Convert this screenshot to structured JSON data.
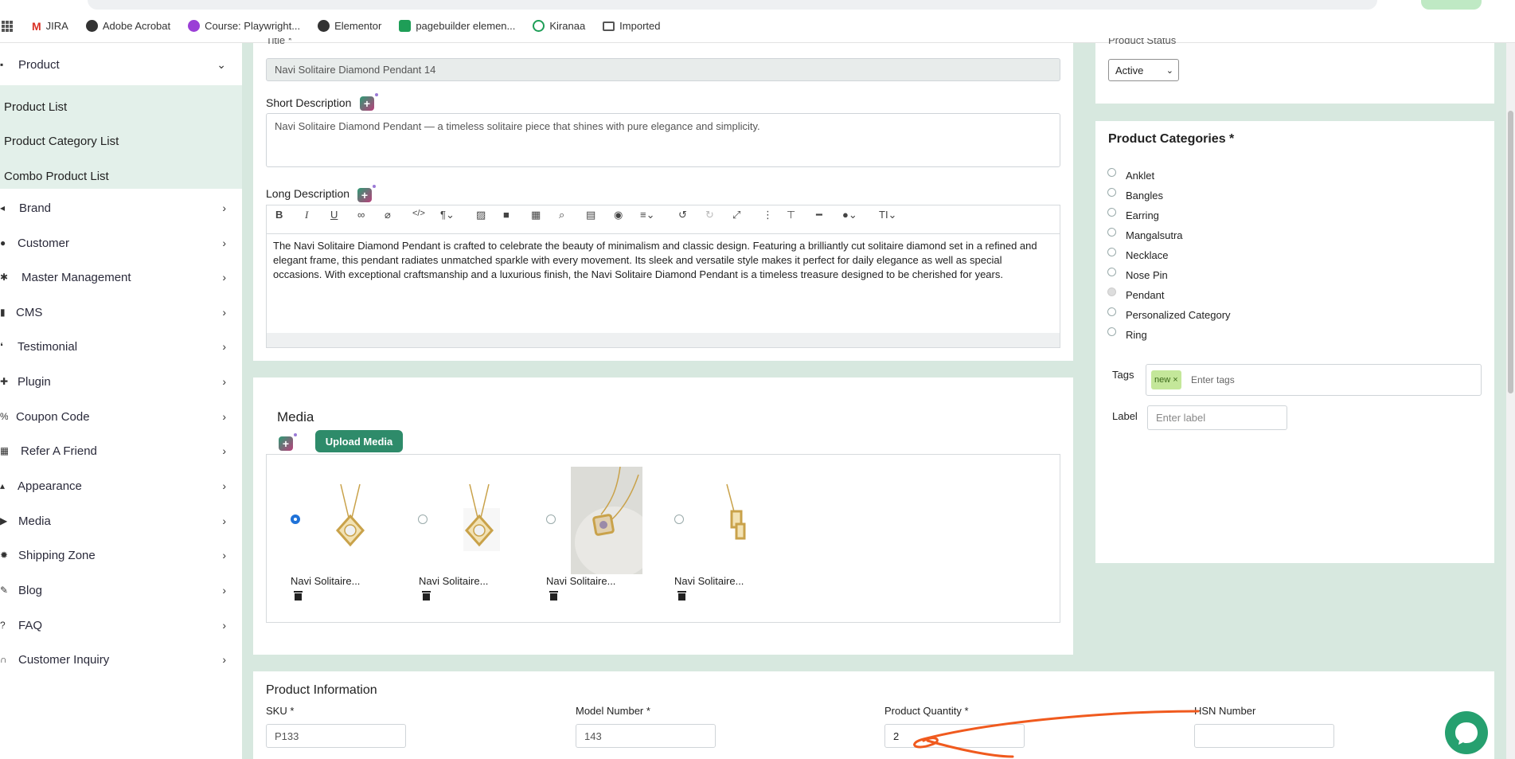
{
  "bookmarks": [
    {
      "label": "JIRA",
      "icon": "gmail-icon"
    },
    {
      "label": "Adobe Acrobat",
      "icon": "globe-icon"
    },
    {
      "label": "Course: Playwright...",
      "icon": "course-icon"
    },
    {
      "label": "Elementor",
      "icon": "globe-icon"
    },
    {
      "label": "pagebuilder elemen...",
      "icon": "sheets-icon"
    },
    {
      "label": "Kiranaa",
      "icon": "check-icon"
    },
    {
      "label": "Imported",
      "icon": "folder-icon"
    }
  ],
  "sidebar": {
    "product": {
      "label": "Product",
      "submenu": [
        "Product List",
        "Product Category List",
        "Combo Product List"
      ]
    },
    "items": [
      "Brand",
      "Customer",
      "Master Management",
      "CMS",
      "Testimonial",
      "Plugin",
      "Coupon Code",
      "Refer A Friend",
      "Appearance",
      "Media",
      "Shipping Zone",
      "Blog",
      "FAQ",
      "Customer Inquiry"
    ]
  },
  "form": {
    "title_label": "Title *",
    "title_value": "Navi Solitaire Diamond Pendant 14",
    "short_desc_label": "Short Description",
    "short_desc_value": "Navi Solitaire Diamond Pendant — a timeless solitaire piece that shines with pure elegance and simplicity.",
    "long_desc_label": "Long Description",
    "long_desc_value": "The Navi Solitaire Diamond Pendant is crafted to celebrate the beauty of minimalism and classic design. Featuring a brilliantly cut solitaire diamond set in a refined and elegant frame, this pendant radiates unmatched sparkle with every movement. Its sleek and versatile style makes it perfect for daily elegance as well as special occasions. With exceptional craftsmanship and a luxurious finish, the Navi Solitaire Diamond Pendant is a timeless treasure designed to be cherished for years."
  },
  "media": {
    "title": "Media",
    "upload_label": "Upload Media",
    "items": [
      {
        "name": "Navi Solitaire...",
        "selected": true
      },
      {
        "name": "Navi Solitaire...",
        "selected": false
      },
      {
        "name": "Navi Solitaire...",
        "selected": false
      },
      {
        "name": "Navi Solitaire...",
        "selected": false
      }
    ]
  },
  "status": {
    "label": "Product Status",
    "value": "Active"
  },
  "categories": {
    "title": "Product Categories *",
    "items": [
      {
        "label": "Anklet",
        "checked": false
      },
      {
        "label": "Bangles",
        "checked": false
      },
      {
        "label": "Earring",
        "checked": false
      },
      {
        "label": "Mangalsutra",
        "checked": false
      },
      {
        "label": "Necklace",
        "checked": false
      },
      {
        "label": "Nose Pin",
        "checked": false
      },
      {
        "label": "Pendant",
        "checked": true
      },
      {
        "label": "Personalized Category",
        "checked": false
      },
      {
        "label": "Ring",
        "checked": false
      }
    ],
    "tags_label": "Tags",
    "tag_chip": "new",
    "tags_placeholder": "Enter tags",
    "label_label": "Label",
    "label_placeholder": "Enter label"
  },
  "product_info": {
    "title": "Product Information",
    "sku_label": "SKU *",
    "sku_value": "P133",
    "model_label": "Model Number *",
    "model_value": "143",
    "qty_label": "Product Quantity *",
    "qty_value": "2",
    "hsn_label": "HSN Number",
    "hsn_value": ""
  },
  "colors": {
    "accent_green": "#2e8b6a",
    "annotation_orange": "#f05a1e",
    "page_bg": "#d7e8df"
  }
}
